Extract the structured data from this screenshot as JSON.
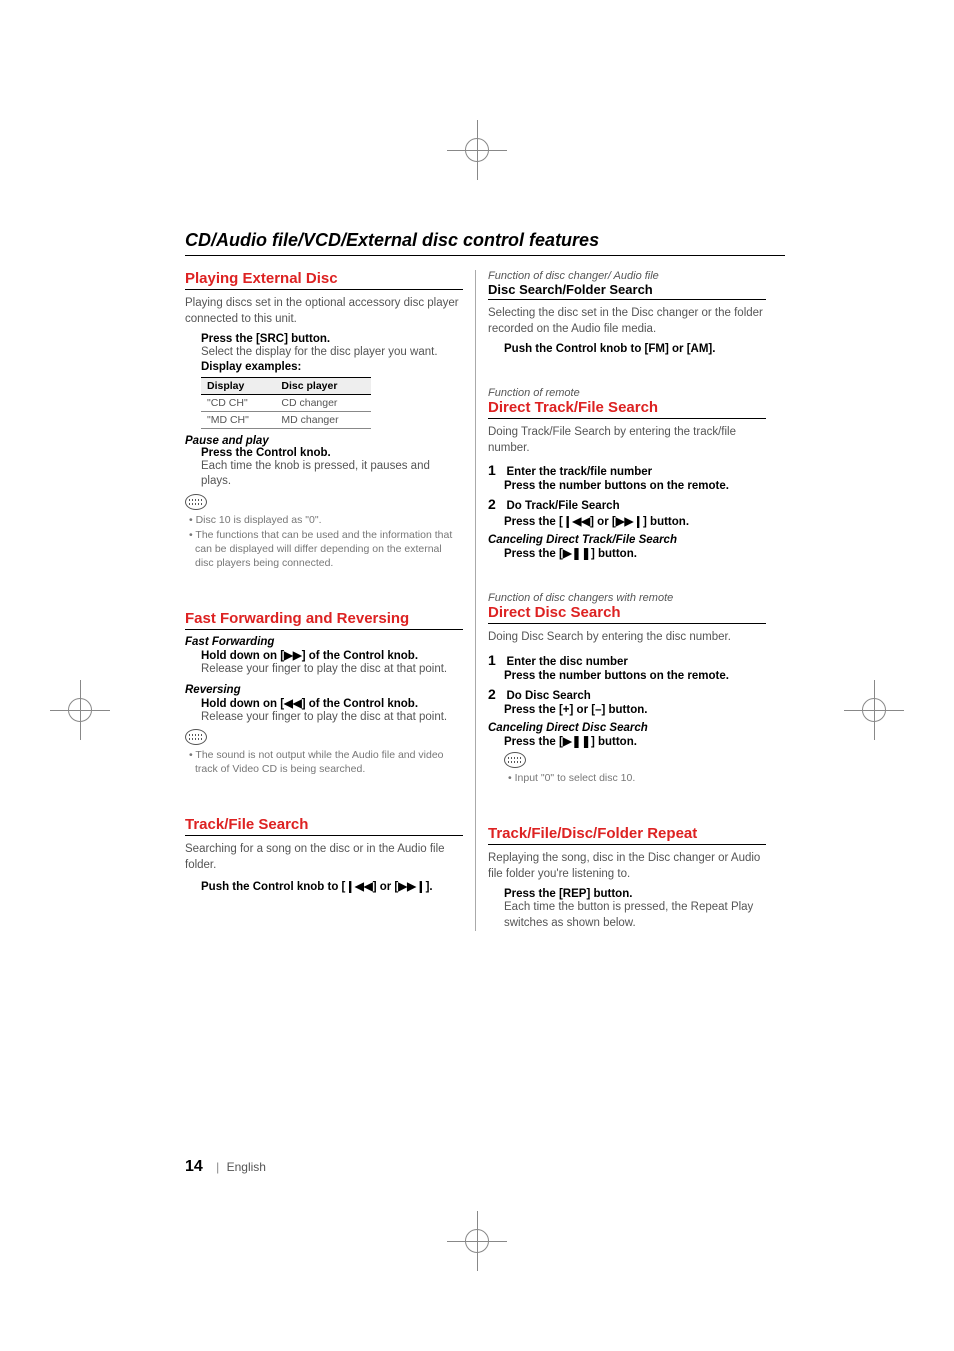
{
  "chapter_title": "CD/Audio file/VCD/External disc control features",
  "left": {
    "s1": {
      "heading": "Playing External Disc",
      "intro": "Playing discs set in the optional accessory disc player connected to this unit.",
      "step_cmd": "Press the [SRC] button.",
      "step_body": "Select the display for the disc player you want.",
      "examples_label": "Display examples:",
      "table": {
        "h1": "Display",
        "h2": "Disc player",
        "rows": [
          {
            "c1": "\"CD CH\"",
            "c2": "CD changer"
          },
          {
            "c1": "\"MD CH\"",
            "c2": "MD changer"
          }
        ]
      },
      "pause_hd": "Pause and play",
      "pause_cmd": "Press the Control knob.",
      "pause_body": "Each time the knob is pressed, it pauses and plays.",
      "notes": [
        "Disc 10 is displayed as \"0\".",
        "The functions that can be used and the information that can be displayed will differ depending on the external disc players being connected."
      ]
    },
    "s2": {
      "heading": "Fast Forwarding and Reversing",
      "ff_hd": "Fast Forwarding",
      "ff_cmd_pre": "Hold down on [",
      "ff_cmd_post": "] of the Control knob.",
      "ff_body": "Release your finger to play the disc at that point.",
      "rev_hd": "Reversing",
      "rev_cmd_pre": "Hold down on [",
      "rev_cmd_post": "] of the Control knob.",
      "rev_body": "Release your finger to play the disc at that point.",
      "note": "The sound is not output while the Audio file and video track of Video CD is being searched."
    },
    "s3": {
      "heading": "Track/File Search",
      "intro": "Searching for a song on the disc or in the Audio file folder.",
      "cmd_pre": "Push the Control knob to [",
      "cmd_mid": "] or [",
      "cmd_post": "]."
    }
  },
  "right": {
    "s1": {
      "context": "Function of disc changer/ Audio file",
      "heading": "Disc Search/Folder Search",
      "intro": "Selecting the disc set in the Disc changer or the folder recorded on the Audio file media.",
      "cmd": "Push the Control knob to [FM] or [AM]."
    },
    "s2": {
      "context": "Function of remote",
      "heading": "Direct Track/File Search",
      "intro": "Doing Track/File Search by entering the track/file number.",
      "step1_title": "Enter the track/file number",
      "step1_cmd": "Press the number buttons on the remote.",
      "step2_title": "Do Track/File Search",
      "step2_pre": "Press the [",
      "step2_mid": "] or [",
      "step2_post": "] button.",
      "cancel_hd": "Canceling Direct Track/File Search",
      "cancel_pre": "Press the [",
      "cancel_post": "] button."
    },
    "s3": {
      "context": "Function of disc changers with remote",
      "heading": "Direct Disc Search",
      "intro": "Doing Disc Search by entering the disc number.",
      "step1_title": "Enter the disc number",
      "step1_cmd": "Press the number buttons on the remote.",
      "step2_title": "Do Disc Search",
      "step2_cmd": "Press the [+] or [–] button.",
      "cancel_hd": "Canceling Direct Disc Search",
      "cancel_pre": "Press the [",
      "cancel_post": "] button.",
      "note": "Input \"0\" to select disc 10."
    },
    "s4": {
      "heading": "Track/File/Disc/Folder Repeat",
      "intro": "Replaying the song, disc in the Disc changer or Audio file folder you're listening to.",
      "cmd": "Press the [REP] button.",
      "body": "Each time the button is pressed, the Repeat Play switches as shown below."
    }
  },
  "glyphs": {
    "ff": "▶▶",
    "rw": "◀◀",
    "skip_f": "▶▶❙",
    "skip_b": "❙◀◀",
    "playpause": "▶❚❚"
  },
  "footer": {
    "page": "14",
    "lang": "English"
  }
}
